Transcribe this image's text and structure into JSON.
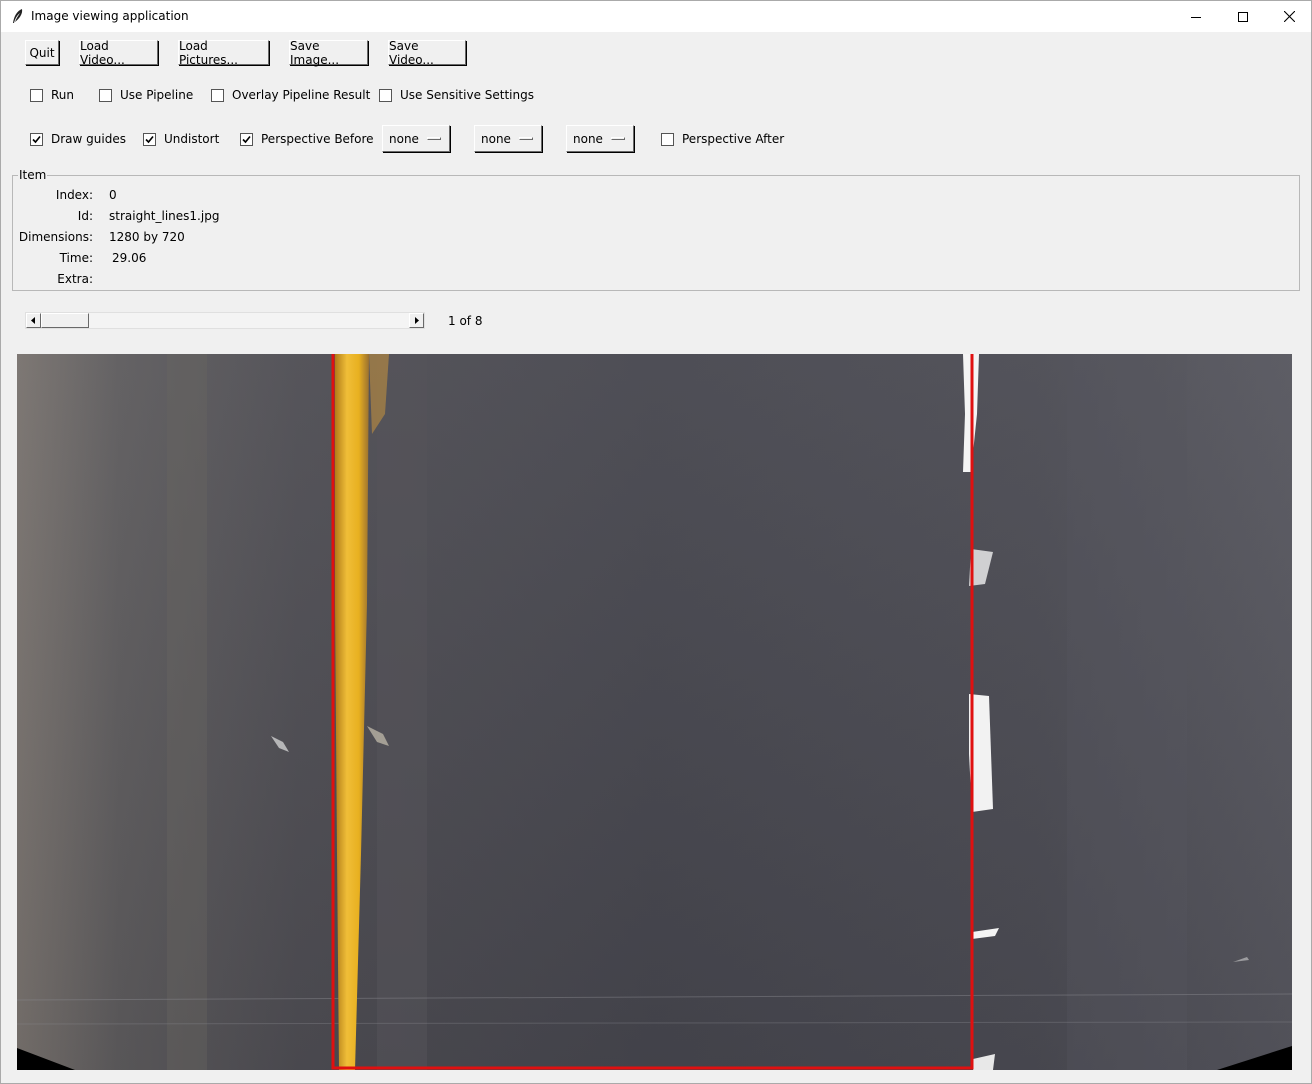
{
  "window": {
    "title": "Image viewing application"
  },
  "toolbar": {
    "quit": "Quit",
    "load_video": "Load Video...",
    "load_pictures": "Load Pictures...",
    "save_image": "Save Image...",
    "save_video": "Save Video..."
  },
  "options_row1": {
    "run": {
      "label": "Run",
      "checked": false
    },
    "use_pipeline": {
      "label": "Use Pipeline",
      "checked": false
    },
    "overlay_pipeline_result": {
      "label": "Overlay Pipeline Result",
      "checked": false
    },
    "use_sensitive_settings": {
      "label": "Use Sensitive Settings",
      "checked": false
    }
  },
  "options_row2": {
    "draw_guides": {
      "label": "Draw guides",
      "checked": true
    },
    "undistort": {
      "label": "Undistort",
      "checked": true
    },
    "perspective_before": {
      "label": "Perspective Before",
      "checked": true
    },
    "dropdown1": "none",
    "dropdown2": "none",
    "dropdown3": "none",
    "perspective_after": {
      "label": "Perspective After",
      "checked": false
    }
  },
  "item": {
    "legend": "Item",
    "index_label": "Index:",
    "index_value": "0",
    "id_label": "Id:",
    "id_value": "straight_lines1.jpg",
    "dimensions_label": "Dimensions:",
    "dimensions_value": "1280 by 720",
    "time_label": "Time:",
    "time_value": "29.06",
    "extra_label": "Extra:",
    "extra_value": ""
  },
  "navigator": {
    "position_text": "1 of 8",
    "current": 1,
    "total": 8
  },
  "colors": {
    "guide_line": "#e01010",
    "road": "#45454d",
    "yellow_lane": "#e8b020",
    "white_lane": "#f4f4f4"
  },
  "icons": {
    "app": "feather-icon",
    "minimize": "minimize-icon",
    "maximize": "maximize-icon",
    "close": "close-icon"
  }
}
